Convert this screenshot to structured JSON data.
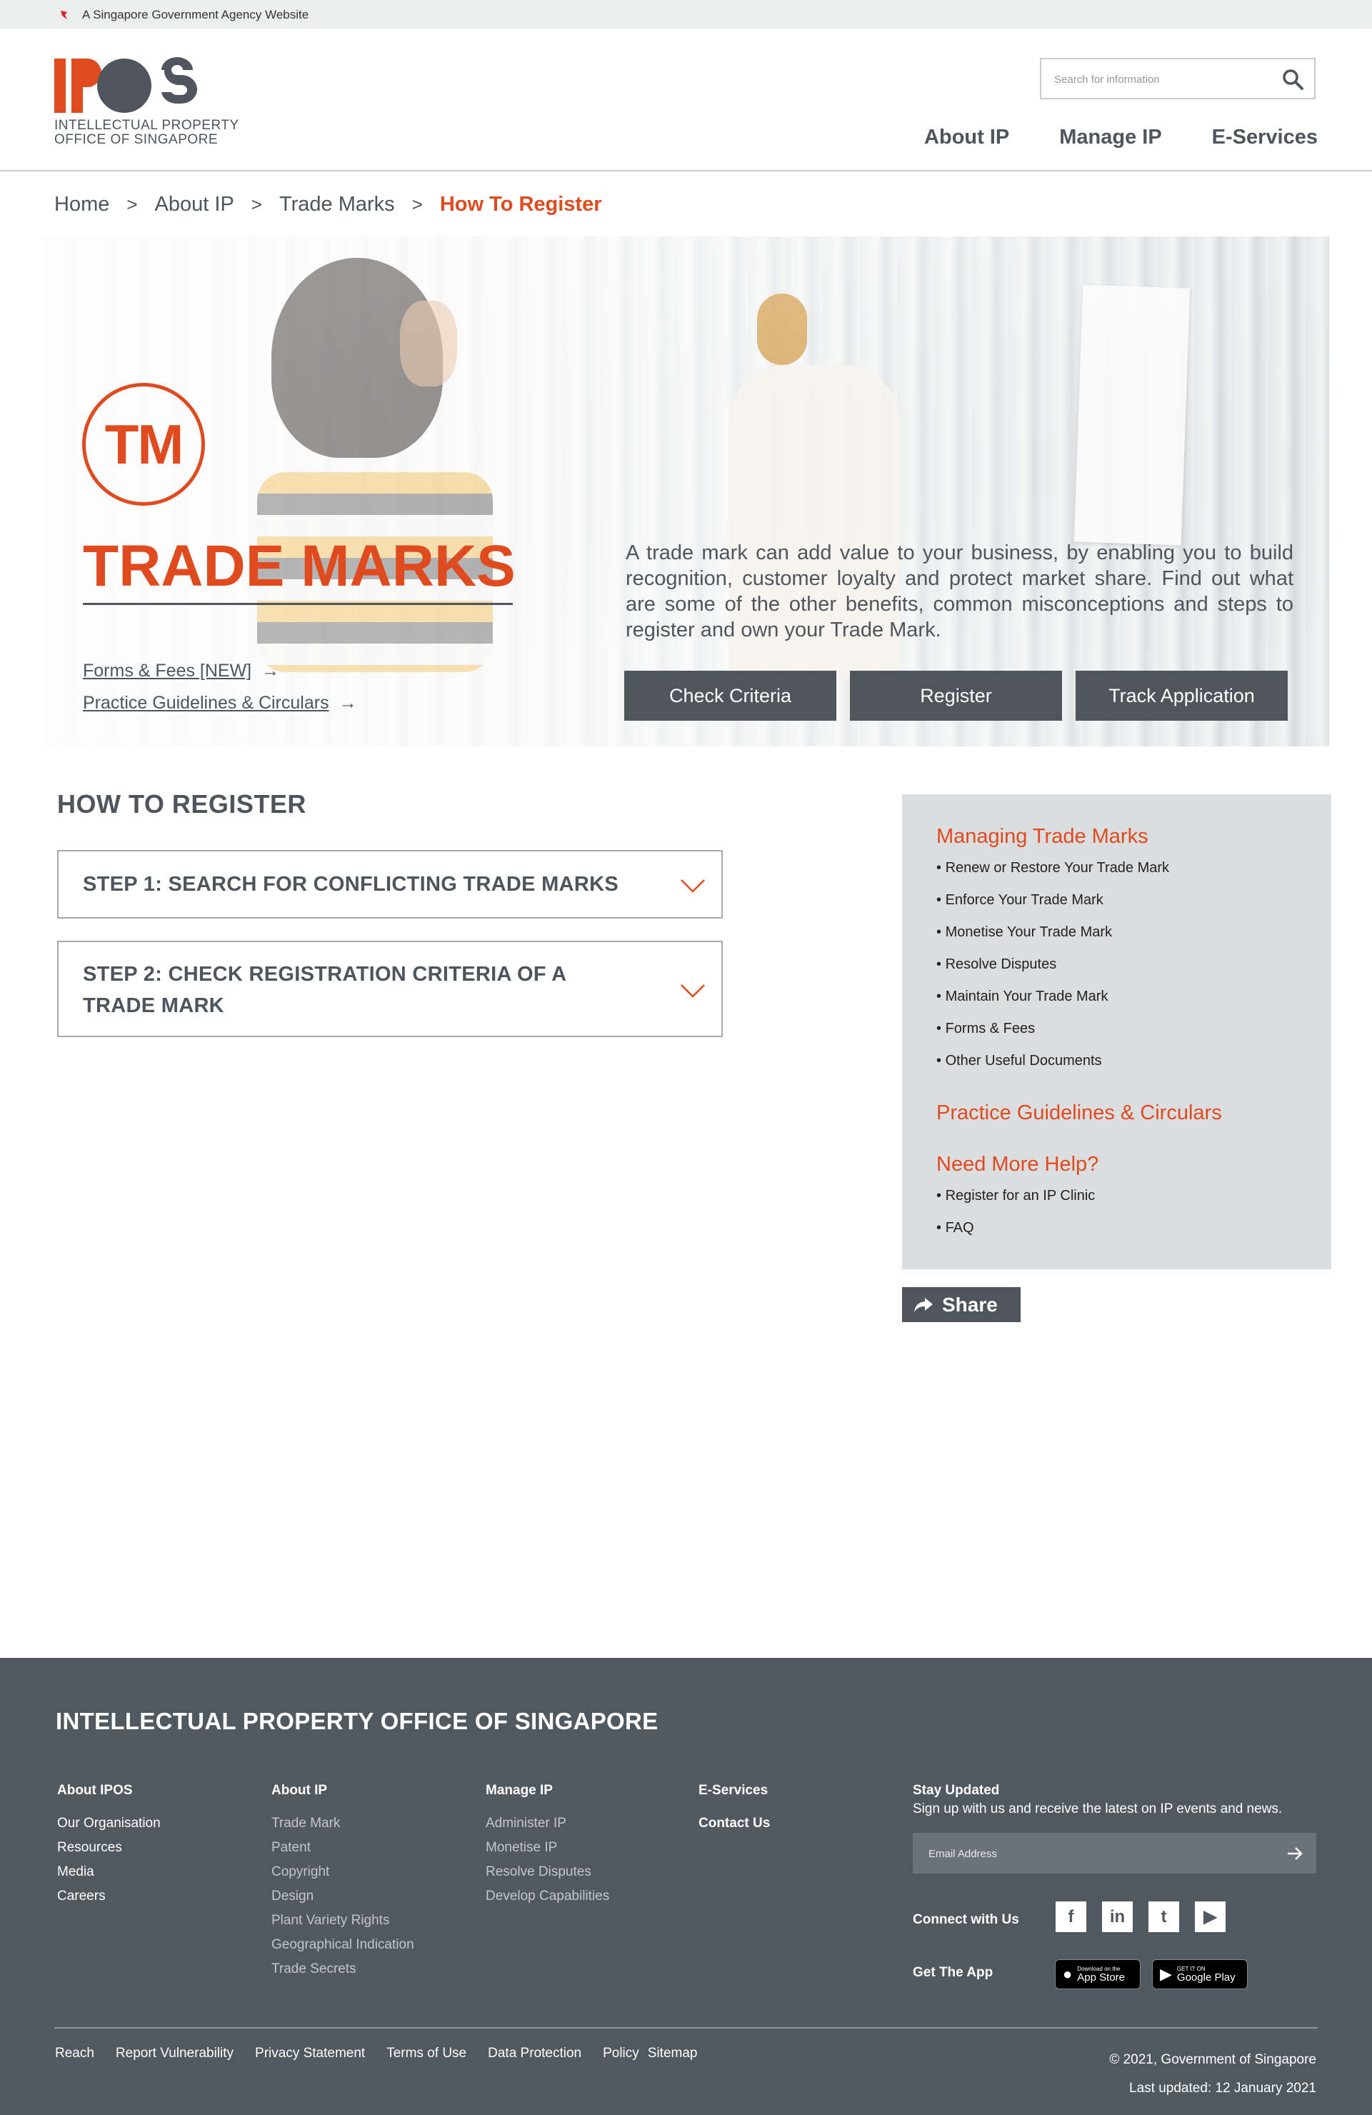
{
  "gov_bar": {
    "text": "A Singapore Government Agency Website"
  },
  "header": {
    "logo_text": "IPOS",
    "logo_line1": "INTELLECTUAL PROPERTY",
    "logo_line2": "OFFICE OF SINGAPORE",
    "search_placeholder": "Search for information",
    "nav": [
      "About IP",
      "Manage IP",
      "E-Services"
    ]
  },
  "breadcrumb": {
    "items": [
      "Home",
      "About IP",
      "Trade Marks"
    ],
    "separator": ">",
    "current": "How To Register"
  },
  "hero": {
    "badge": "TM",
    "title": "TRADE MARKS",
    "links": [
      {
        "label": "Forms & Fees [NEW]",
        "arrow": "→"
      },
      {
        "label": "Practice Guidelines & Circulars",
        "arrow": "→"
      }
    ],
    "description": "A trade mark can add value to your business, by enabling you to build recognition, customer loyalty and protect market share. Find out what are some of the other benefits, common misconceptions and steps to register and own your Trade Mark.",
    "buttons": [
      "Check Criteria",
      "Register",
      "Track Application"
    ]
  },
  "main": {
    "section_title": "HOW TO REGISTER",
    "steps": [
      "STEP 1: SEARCH FOR CONFLICTING TRADE MARKS",
      "STEP 2: CHECK REGISTRATION CRITERIA OF A TRADE MARK"
    ]
  },
  "sidebar": {
    "managing_title": "Managing Trade Marks",
    "managing_items": [
      "Renew or Restore Your Trade Mark",
      "Enforce Your Trade Mark",
      "Monetise Your Trade Mark",
      "Resolve Disputes",
      "Maintain Your Trade Mark",
      "Forms & Fees",
      "Other Useful Documents"
    ],
    "practice_title": "Practice Guidelines & Circulars",
    "help_title": "Need More Help?",
    "help_items": [
      "Register for an IP Clinic",
      "FAQ"
    ],
    "share_label": "Share"
  },
  "footer": {
    "org": "INTELLECTUAL PROPERTY OFFICE OF SINGAPORE",
    "columns": [
      {
        "heading": "About IPOS",
        "items": [
          "Our Organisation",
          "Resources",
          "Media",
          "Careers"
        ]
      },
      {
        "heading": "About IP",
        "items": [
          "Trade Mark",
          "Patent",
          "Copyright",
          "Design",
          "Plant Variety Rights",
          "Geographical Indication",
          "Trade Secrets"
        ]
      },
      {
        "heading": "Manage IP",
        "items": [
          "Administer IP",
          "Monetise IP",
          "Resolve Disputes",
          "Develop Capabilities"
        ]
      },
      {
        "heading": "E-Services",
        "items": [
          "Contact Us"
        ]
      }
    ],
    "stay_updated": "Stay Updated",
    "stay_text": "Sign up with us and receive the latest on IP events and news.",
    "email_placeholder": "Email Address",
    "connect": "Connect with Us",
    "social": [
      {
        "icon": "facebook-icon",
        "glyph": "f"
      },
      {
        "icon": "linkedin-icon",
        "glyph": "in"
      },
      {
        "icon": "twitter-icon",
        "glyph": "t"
      },
      {
        "icon": "youtube-icon",
        "glyph": "▶"
      }
    ],
    "get_app": "Get The App",
    "app_store_small": "Download on the",
    "app_store_big": "App Store",
    "play_small": "GET IT ON",
    "play_big": "Google Play",
    "bottom_links": [
      "Reach",
      "Report Vulnerability",
      "Privacy Statement",
      "Terms of Use",
      "Data Protection",
      "Policy",
      "Sitemap"
    ],
    "copyright": "© 2021, Government of Singapore",
    "last_updated": "Last updated: 12 January 2021"
  },
  "colors": {
    "accent": "#e04a1f",
    "slate": "#4e555d",
    "footer_bg": "#515960",
    "sidebar_bg": "#dcdddf"
  }
}
